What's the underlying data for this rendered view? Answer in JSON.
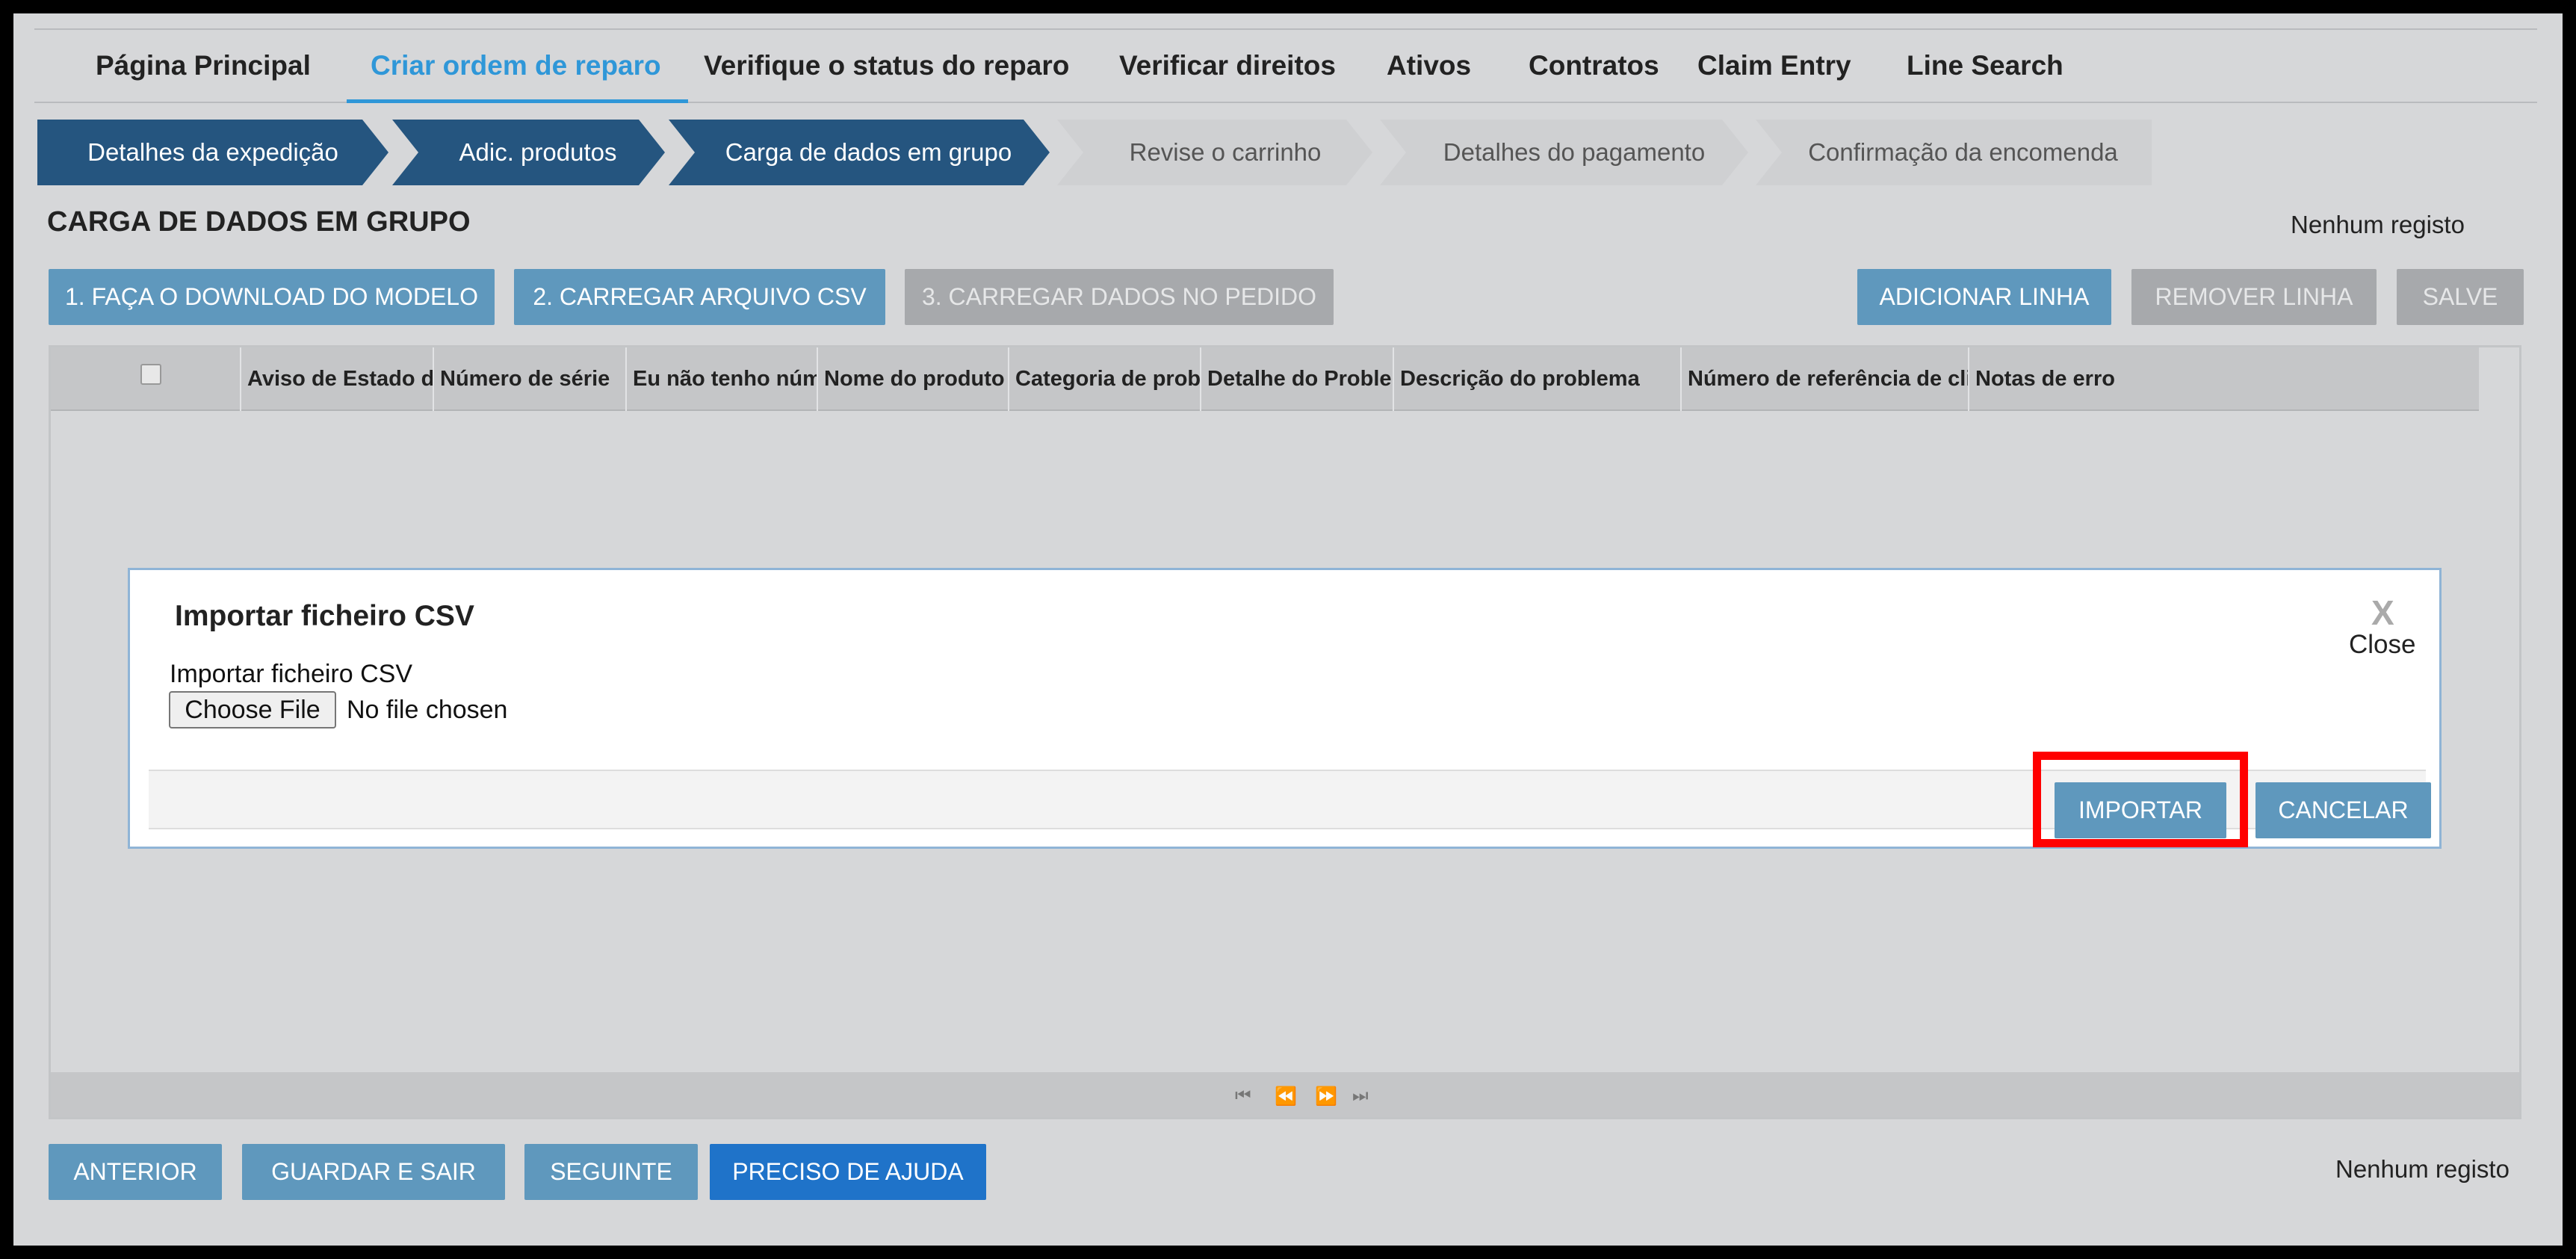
{
  "top_nav": {
    "items": [
      {
        "label": "Página Principal"
      },
      {
        "label": "Criar ordem de reparo",
        "active": true
      },
      {
        "label": "Verifique o status do reparo"
      },
      {
        "label": "Verificar direitos"
      },
      {
        "label": "Ativos"
      },
      {
        "label": "Contratos"
      },
      {
        "label": "Claim Entry"
      },
      {
        "label": "Line Search"
      }
    ]
  },
  "steps": [
    {
      "label": "Detalhes da expedição",
      "state": "done"
    },
    {
      "label": "Adic. produtos",
      "state": "done"
    },
    {
      "label": "Carga de dados em grupo",
      "state": "current"
    },
    {
      "label": "Revise o carrinho",
      "state": "todo"
    },
    {
      "label": "Detalhes do pagamento",
      "state": "todo"
    },
    {
      "label": "Confirmação da encomenda",
      "state": "todo"
    }
  ],
  "section": {
    "title": "CARGA DE DADOS EM GRUPO",
    "record_status": "Nenhum registo"
  },
  "actions": {
    "download_template": "1. FAÇA O DOWNLOAD DO MODELO",
    "upload_csv": "2. CARREGAR ARQUIVO CSV",
    "load_into_order": "3. CARREGAR DADOS NO PEDIDO",
    "add_line": "ADICIONAR LINHA",
    "remove_line": "REMOVER LINHA",
    "save": "SALVE"
  },
  "grid": {
    "columns": [
      "Aviso de Estado d",
      "Número de série",
      "Eu não tenho núm",
      "Nome do produto",
      "Categoria de probl",
      "Detalhe do Problem",
      "Descrição do problema",
      "Número de referência de clie",
      "Notas de erro"
    ]
  },
  "modal": {
    "title": "Importar ficheiro CSV",
    "close_label": "Close",
    "close_glyph": "X",
    "field_label": "Importar ficheiro CSV",
    "choose_file": "Choose File",
    "file_status": "No file chosen",
    "import": "IMPORTAR",
    "cancel": "CANCELAR"
  },
  "footer": {
    "previous": "ANTERIOR",
    "save_exit": "GUARDAR E SAIR",
    "next": "SEGUINTE",
    "help": "PRECISO DE AJUDA",
    "record_status": "Nenhum registo"
  },
  "colors": {
    "accent": "#2f97d8",
    "step_done": "#25557f",
    "button_light": "#5f98bd",
    "button_primary": "#1f73c9",
    "highlight": "#ff0000"
  }
}
